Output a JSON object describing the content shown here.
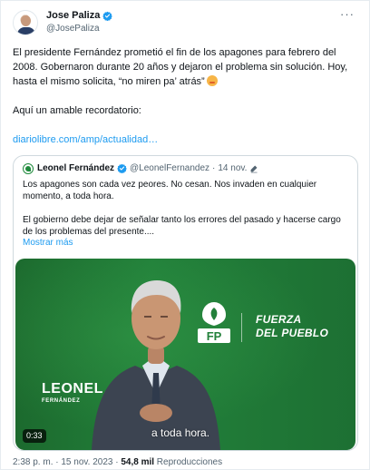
{
  "tweet": {
    "author_name": "Jose Paliza",
    "handle": "@JosePaliza",
    "more_label": "···",
    "text_line1": "El presidente Fernández prometió el fin de los apagones para febrero del 2008. Gobernaron durante 20 años y dejaron el problema sin solución. Hoy, hasta el mismo solicita, “no miren pa’ atrás”",
    "emoji": "face-emoji",
    "reminder": "Aquí un amable recordatorio:",
    "link": "diariolibre.com/amp/actualidad…"
  },
  "quote": {
    "author_name": "Leonel Fernández",
    "handle": "@LeonelFernandez",
    "separator": "·",
    "date": "14 nov.",
    "paragraph1": "Los apagones son cada vez peores. No cesan. Nos invaden en cualquier momento, a toda hora.",
    "paragraph2": "El gobierno debe dejar de señalar tanto los errores del pasado y hacerse cargo de los problemas del presente....",
    "show_more": "Mostrar más"
  },
  "video": {
    "brand_line1": "FUERZA",
    "brand_line2": "DEL PUEBLO",
    "logo_text": "FP",
    "name_first": "LEONEL",
    "name_last": "FERNÁNDEZ",
    "subtitle": "a toda hora.",
    "duration": "0:33"
  },
  "footer": {
    "time_date": "2:38 p. m. · 15 nov. 2023 · ",
    "views": "54,8 mil",
    "views_label": " Reproducciones"
  },
  "colors": {
    "accent": "#1d9bf0",
    "text": "#0f1419",
    "muted": "#536471",
    "video_green": "#22803a"
  }
}
